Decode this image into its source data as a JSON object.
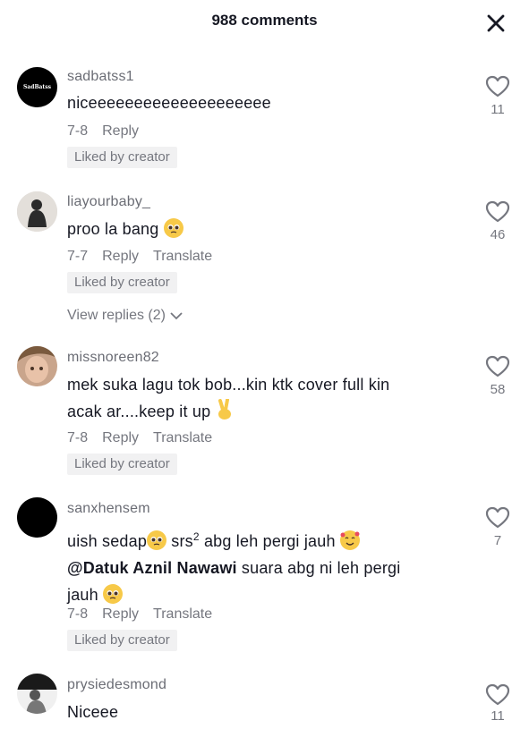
{
  "header": {
    "title": "988 comments",
    "close_icon": "close-icon"
  },
  "comments": [
    {
      "username": "sadbatss1",
      "avatar_text": "SadBatss",
      "text": "niceeeeeeeeeeeeeeeeeeee",
      "date": "7-8",
      "reply_label": "Reply",
      "translate_label": "",
      "badge": "Liked by creator",
      "likes": "11"
    },
    {
      "username": "liayourbaby_",
      "text": "proo la bang",
      "date": "7-7",
      "reply_label": "Reply",
      "translate_label": "Translate",
      "badge": "Liked by creator",
      "likes": "46",
      "view_replies": "View replies (2)"
    },
    {
      "username": "missnoreen82",
      "text_line1": "mek suka lagu tok bob...kin ktk cover full kin",
      "text_line2": "acak ar....keep it up",
      "date": "7-8",
      "reply_label": "Reply",
      "translate_label": "Translate",
      "badge": "Liked by creator",
      "likes": "58"
    },
    {
      "username": "sanxhensem",
      "text_a": "uish sedap",
      "text_b": " srs",
      "text_sup": "2",
      "text_c": " abg leh pergi jauh",
      "mention": "@Datuk Aznil Nawawi",
      "text_line2_rest": " suara abg ni leh pergi",
      "text_line3": "jauh",
      "date": "7-8",
      "reply_label": "Reply",
      "translate_label": "Translate",
      "badge": "Liked by creator",
      "likes": "7"
    },
    {
      "username": "prysiedesmond",
      "text": "Niceee",
      "likes": "11"
    }
  ],
  "colors": {
    "text": "#161823",
    "secondary": "#75777f",
    "badge_bg": "#f1f1f2"
  }
}
